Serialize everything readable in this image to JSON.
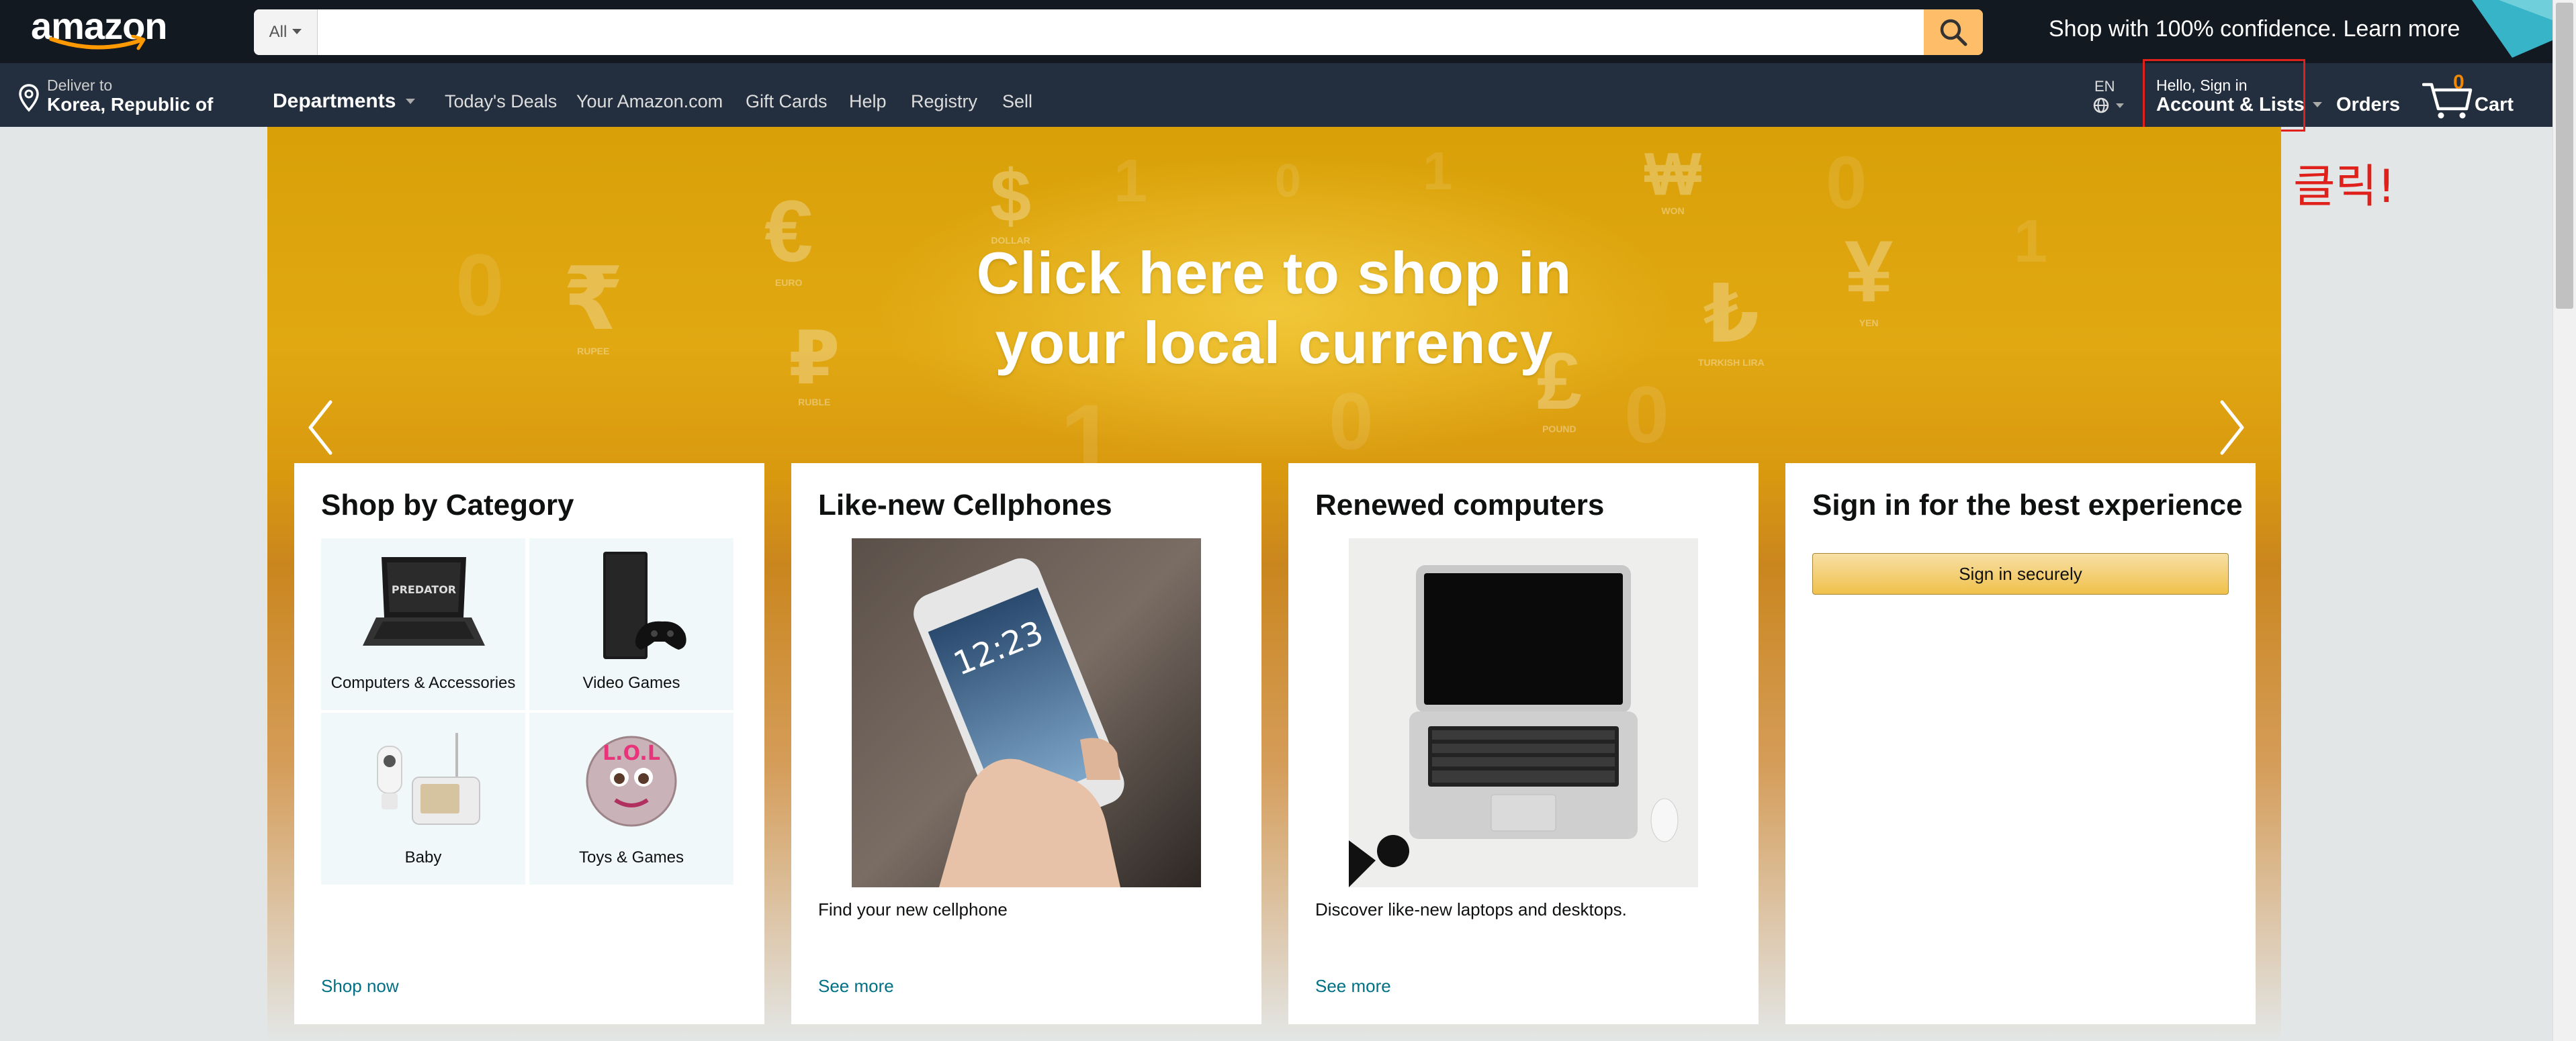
{
  "header": {
    "logo_text": "amazon",
    "search": {
      "dept_label": "All",
      "placeholder": "",
      "value": ""
    },
    "promo_text": "Shop with 100% confidence. Learn more",
    "deliver": {
      "line1": "Deliver to",
      "line2": "Korea, Republic of"
    },
    "departments_label": "Departments",
    "nav_links": [
      "Today's Deals",
      "Your Amazon.com",
      "Gift Cards",
      "Help",
      "Registry",
      "Sell"
    ],
    "language": "EN",
    "account": {
      "line1": "Hello, Sign in",
      "line2": "Account & Lists"
    },
    "orders_label": "Orders",
    "cart": {
      "count": "0",
      "label": "Cart"
    }
  },
  "annotation_text": "클릭!",
  "hero": {
    "title_line1": "Click here to shop in",
    "title_line2": "your local currency",
    "currency_symbols": [
      {
        "symbol": "€",
        "name": "EURO"
      },
      {
        "symbol": "$",
        "name": "DOLLAR"
      },
      {
        "symbol": "₩",
        "name": "WON"
      },
      {
        "symbol": "₹",
        "name": "RUPEE"
      },
      {
        "symbol": "₽",
        "name": "RUBLE"
      },
      {
        "symbol": "£",
        "name": "POUND"
      },
      {
        "symbol": "₺",
        "name": "TURKISH LIRA"
      },
      {
        "symbol": "¥",
        "name": "YEN"
      }
    ]
  },
  "cards": {
    "category": {
      "title": "Shop by Category",
      "tiles": [
        "Computers & Accessories",
        "Video Games",
        "Baby",
        "Toys & Games"
      ],
      "link": "Shop now"
    },
    "cellphones": {
      "title": "Like-new Cellphones",
      "caption": "Find your new cellphone",
      "link": "See more",
      "phone_time": "12:23"
    },
    "computers": {
      "title": "Renewed computers",
      "caption": "Discover like-new laptops and desktops.",
      "link": "See more"
    },
    "signin": {
      "title": "Sign in for the best experience",
      "button": "Sign in securely"
    }
  },
  "colors": {
    "nav_top": "#131921",
    "nav_bottom": "#232f3e",
    "search_button": "#febd69",
    "link": "#007185",
    "highlight_box": "#e0211b"
  }
}
